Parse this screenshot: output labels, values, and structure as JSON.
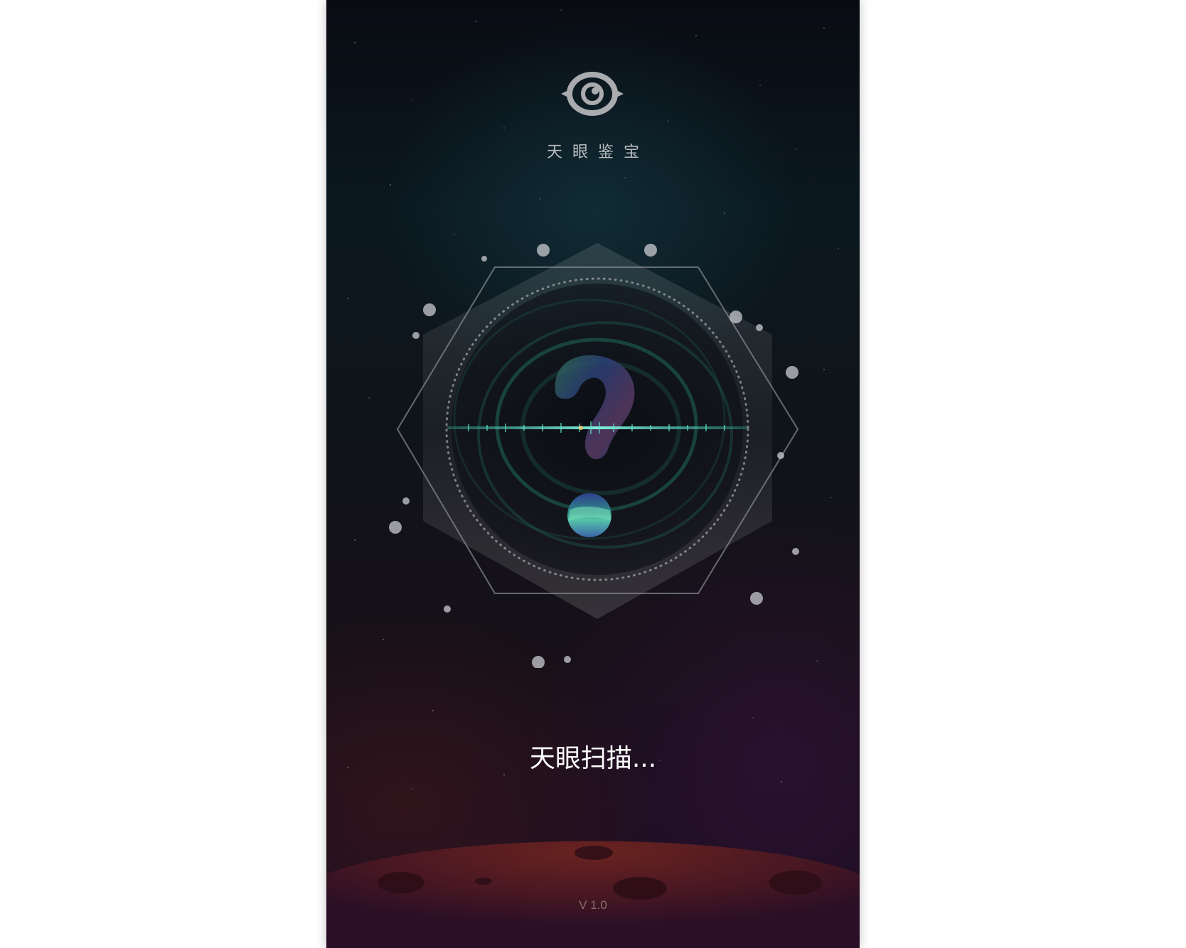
{
  "app": {
    "name": "天眼鉴宝",
    "logo_icon": "eye-icon"
  },
  "scan": {
    "status_text": "天眼扫描...",
    "center_icon": "question-mark-icon"
  },
  "footer": {
    "version": "V 1.0"
  },
  "colors": {
    "background_top": "#090b12",
    "background_bottom": "#1d0d22",
    "logo": "#a9abae",
    "scan_line": "#3fd0b5",
    "planet": "#5a1d1d",
    "status_text": "#ffffff",
    "version_text": "#8a6f70"
  }
}
